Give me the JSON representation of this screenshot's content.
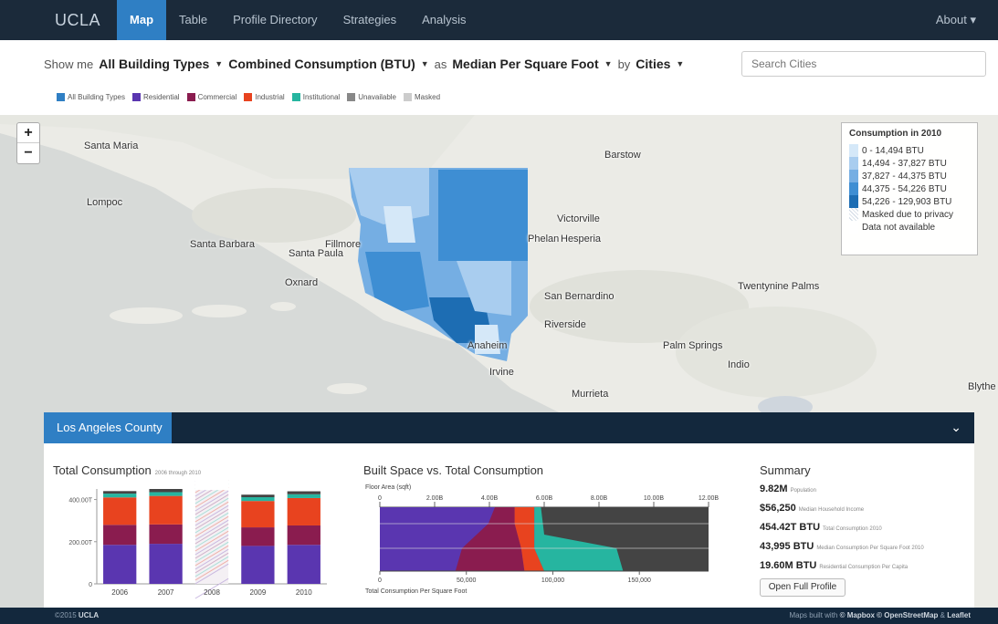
{
  "nav": {
    "brand": "UCLA",
    "items": [
      "Map",
      "Table",
      "Profile Directory",
      "Strategies",
      "Analysis"
    ],
    "right": "About ▾"
  },
  "query": {
    "show_me": "Show me",
    "building_types": "All Building Types",
    "consumption": "Combined Consumption (BTU)",
    "as": "as",
    "metric": "Median Per Square Foot",
    "by": "by",
    "geo": "Cities"
  },
  "search": {
    "placeholder": "Search Cities"
  },
  "type_legend": [
    {
      "label": "All Building Types",
      "color": "#2f7fc4"
    },
    {
      "label": "Residential",
      "color": "#5a36b0"
    },
    {
      "label": "Commercial",
      "color": "#8a1c4f"
    },
    {
      "label": "Industrial",
      "color": "#e8431f"
    },
    {
      "label": "Institutional",
      "color": "#26b5a0"
    },
    {
      "label": "Unavailable",
      "color": "#888888"
    },
    {
      "label": "Masked",
      "color": "#cccccc"
    }
  ],
  "map": {
    "places": [
      "Santa Maria",
      "Lompoc",
      "Santa Barbara",
      "Santa Paula",
      "Fillmore",
      "Oxnard",
      "Barstow",
      "Victorville",
      "Phelan",
      "Hesperia",
      "San Bernardino",
      "Riverside",
      "Anaheim",
      "Irvine",
      "Murrieta",
      "Palm Springs",
      "Indio",
      "Twentynine Palms",
      "Blythe"
    ],
    "legend": {
      "title": "Consumption in 2010",
      "bins": [
        {
          "label": "0 - 14,494 BTU",
          "color": "#d5e8f8"
        },
        {
          "label": "14,494 - 37,827 BTU",
          "color": "#a9cdef"
        },
        {
          "label": "37,827 - 44,375 BTU",
          "color": "#75aee3"
        },
        {
          "label": "44,375 - 54,226 BTU",
          "color": "#3e8ed3"
        },
        {
          "label": "54,226 - 129,903 BTU",
          "color": "#1d6db3"
        }
      ],
      "masked": "Masked due to privacy",
      "na": "Data not available"
    }
  },
  "panel": {
    "tab": "Los Angeles County",
    "total_title": "Total Consumption",
    "total_sub": "2006 through 2010",
    "built_title": "Built Space vs. Total Consumption",
    "summary_title": "Summary",
    "summary": [
      {
        "value": "9.82M",
        "desc": "Population"
      },
      {
        "value": "$56,250",
        "desc": "Median Household Income"
      },
      {
        "value": "454.42T BTU",
        "desc": "Total Consumption 2010"
      },
      {
        "value": "43,995 BTU",
        "desc": "Median Consumption Per Square Foot 2010"
      },
      {
        "value": "19.60M BTU",
        "desc": "Residential Consumption Per Capita"
      }
    ],
    "open_button": "Open Full Profile"
  },
  "chart_data": [
    {
      "type": "bar",
      "title": "Total Consumption",
      "categories": [
        "2006",
        "2007",
        "2008",
        "2009",
        "2010"
      ],
      "ylim": [
        0,
        450
      ],
      "ytick_labels": [
        "0",
        "200.00T",
        "400.00T"
      ],
      "series": [
        {
          "name": "Residential",
          "color": "#5a36b0",
          "values": [
            185,
            190,
            0,
            180,
            185
          ]
        },
        {
          "name": "Commercial",
          "color": "#8a1c4f",
          "values": [
            95,
            92,
            0,
            88,
            92
          ]
        },
        {
          "name": "Industrial",
          "color": "#e8431f",
          "values": [
            130,
            135,
            0,
            125,
            130
          ]
        },
        {
          "name": "Institutional",
          "color": "#26b5a0",
          "values": [
            18,
            18,
            0,
            18,
            18
          ]
        },
        {
          "name": "Unavailable",
          "color": "#444444",
          "values": [
            12,
            15,
            0,
            12,
            14
          ]
        }
      ],
      "masked_category": "2008"
    },
    {
      "type": "area",
      "title": "Built Space vs. Total Consumption",
      "top_axis_label": "Floor Area (sqft)",
      "top_ticks": [
        "0",
        "2.00B",
        "4.00B",
        "6.00B",
        "8.00B",
        "10.00B",
        "12.00B"
      ],
      "bottom_axis_label": "Total Consumption Per Square Foot",
      "bottom_ticks": [
        "0",
        "50,000",
        "100,000",
        "150,000"
      ]
    }
  ]
}
